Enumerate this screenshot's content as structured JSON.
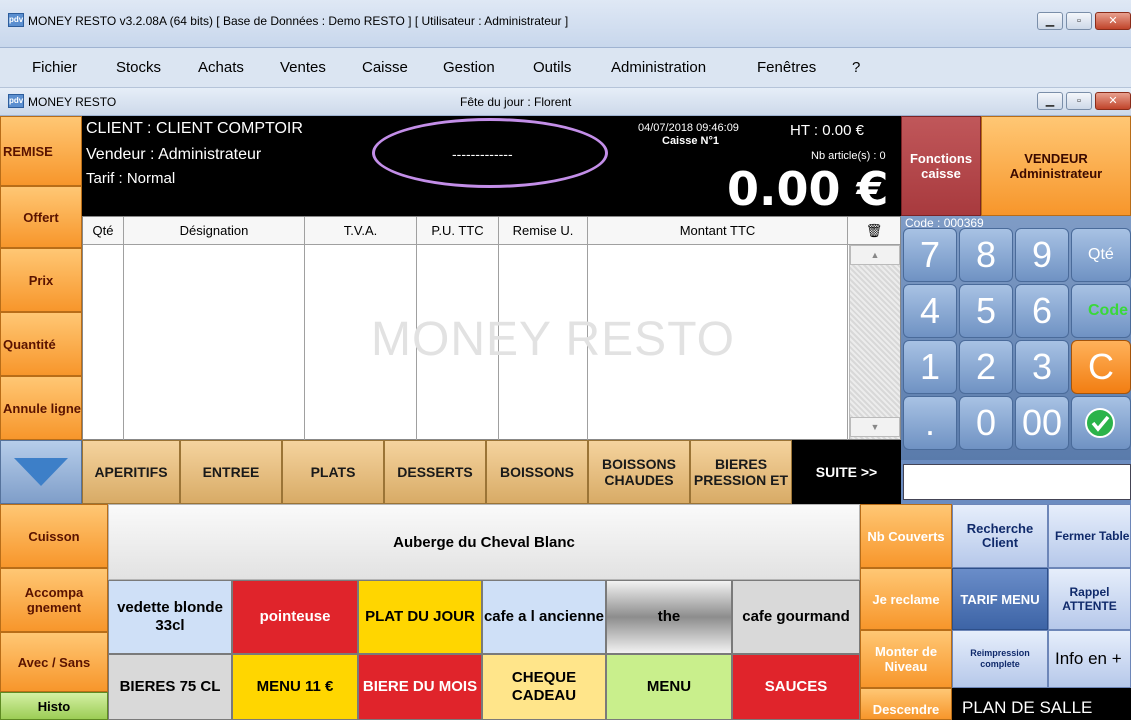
{
  "window": {
    "title": "MONEY RESTO v3.2.08A (64 bits) [ Base de Données : Demo RESTO ] [ Utilisateur : Administrateur ]",
    "icon_label": "pdv"
  },
  "menu": [
    "Fichier",
    "Stocks",
    "Achats",
    "Ventes",
    "Caisse",
    "Gestion",
    "Outils",
    "Administration",
    "Fenêtres",
    "?"
  ],
  "child_window": {
    "title": "MONEY RESTO",
    "fete": "Fête du jour : Florent"
  },
  "left_buttons": {
    "remise": "REMISE",
    "offert": "Offert",
    "prix": "Prix",
    "quantite": "Quantité",
    "annule": "Annule ligne"
  },
  "header": {
    "client": "CLIENT : CLIENT COMPTOIR",
    "vendeur": "Vendeur : Administrateur",
    "tarif": "Tarif : Normal",
    "dashes": "-------------",
    "datetime": "04/07/2018 09:46:09",
    "caisse": "Caisse N°1",
    "ht": "HT : 0.00 €",
    "nb_articles": "Nb article(s) : 0",
    "total": "0.00 €"
  },
  "top_right": {
    "fonctions": "Fonctions caisse",
    "vendeur": "VENDEUR Administrateur"
  },
  "table": {
    "columns": [
      "Qté",
      "Désignation",
      "T.V.A.",
      "P.U. TTC",
      "Remise U.",
      "Montant TTC"
    ],
    "watermark": "MONEY RESTO",
    "rows": []
  },
  "keypad": {
    "code_label": "Code : 000369",
    "keys": [
      "7",
      "8",
      "9",
      "Qté",
      "4",
      "5",
      "6",
      "Code",
      "1",
      "2",
      "3",
      "C",
      ".",
      "0",
      "00"
    ]
  },
  "categories": {
    "items": [
      "APERITIFS",
      "ENTREE",
      "PLATS",
      "DESSERTS",
      "BOISSONS",
      "BOISSONS CHAUDES",
      "BIERES PRESSION ET"
    ],
    "suite": "SUITE >>"
  },
  "side_left": {
    "cuisson": "Cuisson",
    "accompagnement": "Accompa gnement",
    "avec_sans": "Avec / Sans",
    "histo": "Histo"
  },
  "restaurant_name": "Auberge du Cheval Blanc",
  "products": [
    {
      "label": "vedette blonde 33cl",
      "color": "#cfe0f7"
    },
    {
      "label": "pointeuse",
      "color": "#e0242b"
    },
    {
      "label": "PLAT DU JOUR",
      "color": "#ffd600"
    },
    {
      "label": "cafe a l ancienne",
      "color": "#cfe0f7"
    },
    {
      "label": "the",
      "color": "#bbbbbb"
    },
    {
      "label": "cafe gourmand",
      "color": "#d9d9d9"
    },
    {
      "label": "BIERES 75 CL",
      "color": "#d9d9d9"
    },
    {
      "label": "MENU 11 €",
      "color": "#ffd600"
    },
    {
      "label": "BIERE DU MOIS",
      "color": "#e0242b"
    },
    {
      "label": "CHEQUE CADEAU",
      "color": "#ffe58a"
    },
    {
      "label": "MENU",
      "color": "#c9ef8c"
    },
    {
      "label": "SAUCES",
      "color": "#e0242b"
    }
  ],
  "right_buttons": {
    "nb_couverts": "Nb Couverts",
    "recherche_client": "Recherche Client",
    "fermer_table": "Fermer Table",
    "je_reclame": "Je reclame",
    "tarif_menu": "TARIF MENU",
    "rappel_attente": "Rappel ATTENTE",
    "monter_niveau": "Monter de Niveau",
    "reimpression": "Reimpression complete",
    "info": "Info en +",
    "descendre": "Descendre",
    "plan_salle": "PLAN DE SALLE"
  }
}
